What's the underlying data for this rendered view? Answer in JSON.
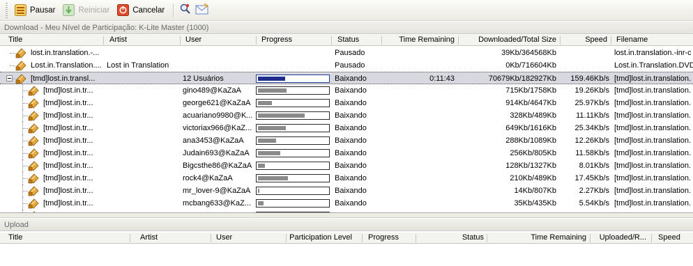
{
  "toolbar": {
    "pause_label": "Pausar",
    "restart_label": "Reiniciar",
    "cancel_label": "Cancelar"
  },
  "download": {
    "section_title": "Download - Meu Nível de Participação: K-Lite Master (1000)",
    "columns": [
      "Title",
      "Artist",
      "User",
      "Progress",
      "Status",
      "Time Remaining",
      "Downloaded/Total Size",
      "Speed",
      "Filename"
    ],
    "rows": [
      {
        "title": "lost.in.translation.-...",
        "artist": "",
        "user": "",
        "progress": null,
        "status": "Pausado",
        "time": "",
        "size": "39Kb/364568Kb",
        "speed": "",
        "filename": "lost.in.translation.-inr-c",
        "level": 0,
        "selected": false
      },
      {
        "title": "Lost.in.Translation....",
        "artist": "Lost in Translation",
        "user": "",
        "progress": null,
        "status": "Pausado",
        "time": "",
        "size": "0Kb/716604Kb",
        "speed": "",
        "filename": "Lost.in.Translation.DVD",
        "level": 0,
        "selected": false
      },
      {
        "title": "[tmd]lost.in.transl...",
        "artist": "",
        "user": "12 Usuários",
        "progress": 0.39,
        "status": "Baixando",
        "time": "0:11:43",
        "size": "70679Kb/182927Kb",
        "speed": "159.46Kb/s",
        "filename": "[tmd]lost.in.translation.",
        "level": 0,
        "selected": true
      },
      {
        "title": "[tmd]lost.in.tr...",
        "artist": "",
        "user": "gino489@KaZaA",
        "progress": 0.41,
        "status": "Baixando",
        "time": "",
        "size": "715Kb/1758Kb",
        "speed": "19.26Kb/s",
        "filename": "[tmd]lost.in.translation.",
        "level": 1,
        "selected": false
      },
      {
        "title": "[tmd]lost.in.tr...",
        "artist": "",
        "user": "george621@KaZaA",
        "progress": 0.2,
        "status": "Baixando",
        "time": "",
        "size": "914Kb/4647Kb",
        "speed": "25.97Kb/s",
        "filename": "[tmd]lost.in.translation.",
        "level": 1,
        "selected": false
      },
      {
        "title": "[tmd]lost.in.tr...",
        "artist": "",
        "user": "acuariano9980@K...",
        "progress": 0.67,
        "status": "Baixando",
        "time": "",
        "size": "328Kb/489Kb",
        "speed": "11.11Kb/s",
        "filename": "[tmd]lost.in.translation.",
        "level": 1,
        "selected": false
      },
      {
        "title": "[tmd]lost.in.tr...",
        "artist": "",
        "user": "victoriax966@KaZ...",
        "progress": 0.4,
        "status": "Baixando",
        "time": "",
        "size": "649Kb/1616Kb",
        "speed": "25.34Kb/s",
        "filename": "[tmd]lost.in.translation.",
        "level": 1,
        "selected": false
      },
      {
        "title": "[tmd]lost.in.tr...",
        "artist": "",
        "user": "ana3453@KaZaA",
        "progress": 0.26,
        "status": "Baixando",
        "time": "",
        "size": "288Kb/1089Kb",
        "speed": "12.26Kb/s",
        "filename": "[tmd]lost.in.translation.",
        "level": 1,
        "selected": false
      },
      {
        "title": "[tmd]lost.in.tr...",
        "artist": "",
        "user": "Judain693@KaZaA",
        "progress": 0.32,
        "status": "Baixando",
        "time": "",
        "size": "256Kb/805Kb",
        "speed": "11.58Kb/s",
        "filename": "[tmd]lost.in.translation.",
        "level": 1,
        "selected": false
      },
      {
        "title": "[tmd]lost.in.tr...",
        "artist": "",
        "user": "Bigcsthe86@KaZaA",
        "progress": 0.1,
        "status": "Baixando",
        "time": "",
        "size": "128Kb/1327Kb",
        "speed": "8.01Kb/s",
        "filename": "[tmd]lost.in.translation.",
        "level": 1,
        "selected": false
      },
      {
        "title": "[tmd]lost.in.tr...",
        "artist": "",
        "user": "rock4@KaZaA",
        "progress": 0.43,
        "status": "Baixando",
        "time": "",
        "size": "210Kb/489Kb",
        "speed": "17.45Kb/s",
        "filename": "[tmd]lost.in.translation.",
        "level": 1,
        "selected": false
      },
      {
        "title": "[tmd]lost.in.tr...",
        "artist": "",
        "user": "mr_lover-9@KaZaA",
        "progress": 0.02,
        "status": "Baixando",
        "time": "",
        "size": "14Kb/807Kb",
        "speed": "2.27Kb/s",
        "filename": "[tmd]lost.in.translation.",
        "level": 1,
        "selected": false
      },
      {
        "title": "[tmd]lost.in.tr...",
        "artist": "",
        "user": "mcbang633@KaZ...",
        "progress": 0.08,
        "status": "Baixando",
        "time": "",
        "size": "35Kb/435Kb",
        "speed": "5.54Kb/s",
        "filename": "[tmd]lost.in.translation.",
        "level": 1,
        "selected": false
      },
      {
        "title": "",
        "artist": "",
        "user": "",
        "progress": 0.1,
        "status": "",
        "time": "",
        "size": "",
        "speed": "",
        "filename": "",
        "level": 1,
        "selected": false
      }
    ]
  },
  "upload": {
    "section_title": "Upload",
    "columns": [
      "Title",
      "Artist",
      "User",
      "Participation Level",
      "Progress",
      "Status",
      "Time Remaining",
      "Uploaded/R...",
      "Speed"
    ]
  }
}
